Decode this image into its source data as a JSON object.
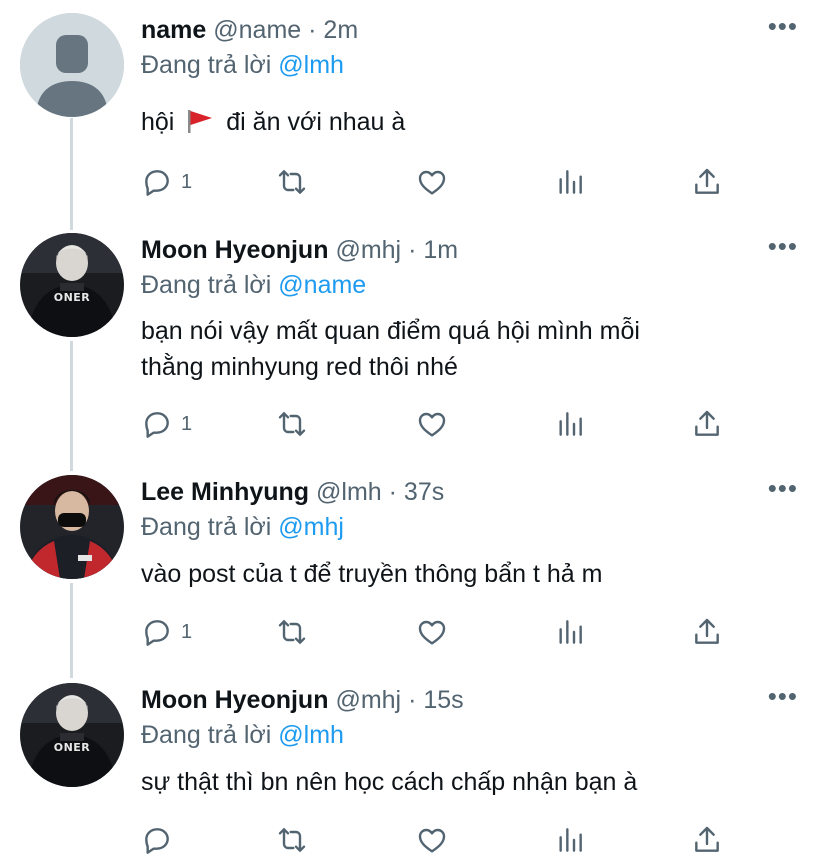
{
  "tweets": [
    {
      "display_name": "name",
      "handle": "@name",
      "separator": "·",
      "time": "2m",
      "reply_prefix": "Đang trả lời",
      "reply_to": "@lmh",
      "text_before_emoji": "hội",
      "emoji": "red-flag-emoji",
      "text_after_emoji": "đi ăn với nhau à",
      "reply_count": "1",
      "avatar": "default-avatar"
    },
    {
      "display_name": "Moon Hyeonjun",
      "handle": "@mhj",
      "separator": "·",
      "time": "1m",
      "reply_prefix": "Đang trả lời",
      "reply_to": "@name",
      "text_line1": "bạn nói vậy mất quan điểm quá hội mình mỗi",
      "text_line2": "thằng minhyung red thôi nhé",
      "reply_count": "1",
      "avatar_jersey": "ONER"
    },
    {
      "display_name": "Lee Minhyung",
      "handle": "@lmh",
      "separator": "·",
      "time": "37s",
      "reply_prefix": "Đang trả lời",
      "reply_to": "@mhj",
      "text": "vào post của t để truyền thông bẩn t hả m",
      "reply_count": "1",
      "avatar": "masked-player-photo"
    },
    {
      "display_name": "Moon Hyeonjun",
      "handle": "@mhj",
      "separator": "·",
      "time": "15s",
      "reply_prefix": "Đang trả lời",
      "reply_to": "@lmh",
      "text": "sự thật thì bn nên học cách chấp nhận bạn à",
      "reply_count": "",
      "avatar_jersey": "ONER"
    }
  ],
  "icons": {
    "more": "more-horizontal-icon",
    "reply": "reply-bubble-icon",
    "retweet": "retweet-icon",
    "like": "heart-icon",
    "analytics": "analytics-bars-icon",
    "share": "share-upload-icon"
  },
  "colors": {
    "accent": "#1d9bf0",
    "secondary_text": "#536471",
    "primary_text": "#0f1419",
    "thread_line": "#cfd9de",
    "icon": "#536471"
  },
  "more_glyph": "•••"
}
